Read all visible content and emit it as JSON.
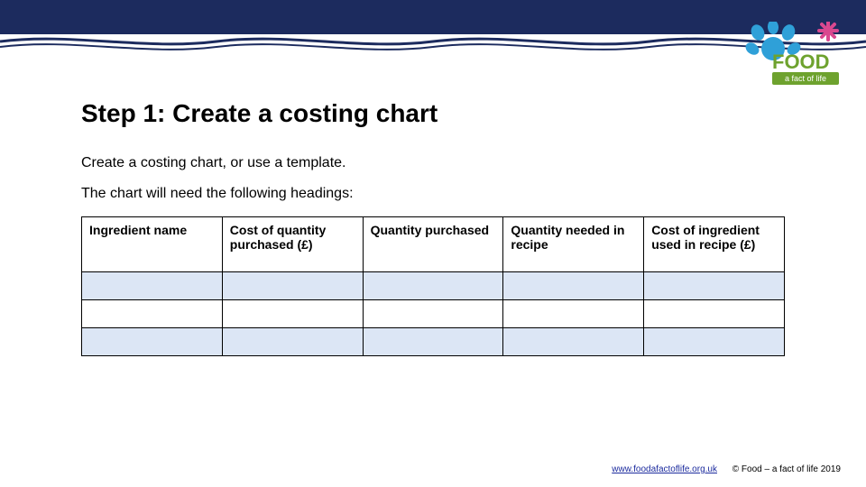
{
  "header": {
    "logo_text_top": "FOOD",
    "logo_text_bottom": "a fact of life"
  },
  "title": "Step 1: Create a costing chart",
  "body": {
    "line1": "Create a costing chart, or use a template.",
    "line2": "The chart will need the following headings:"
  },
  "table": {
    "headers": [
      "Ingredient name",
      "Cost of quantity purchased (£)",
      "Quantity purchased",
      "Quantity needed in recipe",
      "Cost of ingredient used in recipe (£)"
    ]
  },
  "footer": {
    "link_text": "www.foodafactoflife.org.uk",
    "copyright": "© Food – a fact of life 2019"
  }
}
